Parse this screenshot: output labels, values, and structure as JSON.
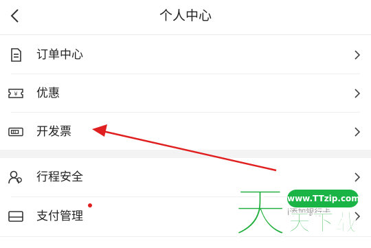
{
  "header": {
    "title": "个人中心",
    "back_icon": "chevron-left-icon"
  },
  "menu_group_1": [
    {
      "label": "订单中心",
      "icon": "document-icon"
    },
    {
      "label": "优惠",
      "icon": "ticket-icon"
    },
    {
      "label": "开发票",
      "icon": "invoice-icon"
    }
  ],
  "menu_group_2": [
    {
      "label": "行程安全",
      "icon": "users-icon"
    },
    {
      "label": "支付管理",
      "icon": "card-icon",
      "has_notification_dot": true
    }
  ],
  "watermark": {
    "url": "www.TTzip.com",
    "big_char": "天",
    "small_text": "天下载",
    "faint_text": "i添加银行卡"
  },
  "annotation": {
    "type": "arrow",
    "color": "#e02020",
    "points_to": "开发票"
  },
  "colors": {
    "accent_red": "#e02020",
    "watermark_green": "#1dad3a",
    "separator": "#efefef",
    "section_gap": "#f3f3f3"
  }
}
